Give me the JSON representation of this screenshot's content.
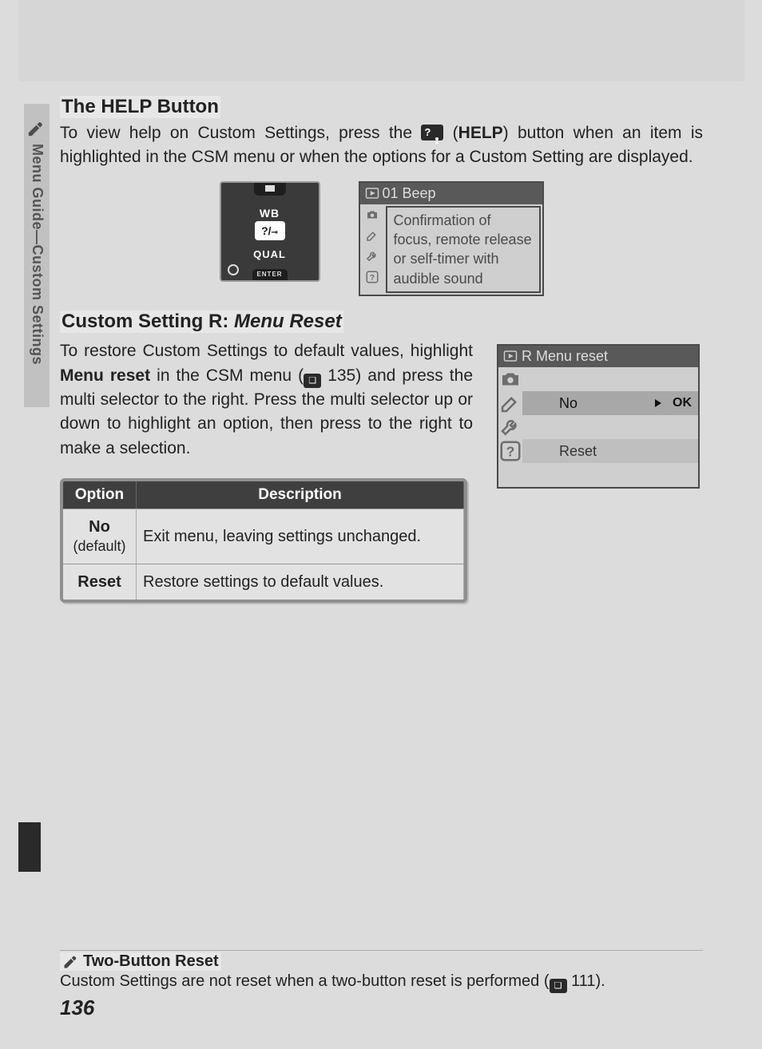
{
  "sidebar": {
    "label": "Menu Guide—Custom Settings"
  },
  "section1": {
    "title": "The HELP Button",
    "para_pre": "To view help on Custom Settings, press the ",
    "help_word": "HELP",
    "para_post": ") button when an item is highlighted in the CSM menu or when the options for a Custom Setting are displayed."
  },
  "camera": {
    "wb": "WB",
    "help": "?/",
    "qual": "QUAL",
    "enter": "ENTER"
  },
  "lcd1": {
    "title": "01 Beep",
    "body": "Confirmation of focus, remote release or self-timer with audible sound"
  },
  "section2": {
    "title_pre": "Custom Setting R: ",
    "title_em": "Menu Reset",
    "para_a": "To restore Custom Settings to default values, highlight ",
    "para_bold": "Menu reset",
    "para_b": " in the CSM menu (",
    "para_ref": " 135) and press the multi selector to the right.  Press the multi selector up or down to highlight an option, then press to the right to make a selection."
  },
  "lcd2": {
    "title": "R Menu reset",
    "row_no": "No",
    "row_ok": "OK",
    "row_reset": "Reset"
  },
  "table": {
    "h1": "Option",
    "h2": "Description",
    "rows": [
      {
        "opt_bold": "No",
        "opt_paren": "(default)",
        "desc": "Exit menu, leaving settings unchanged."
      },
      {
        "opt_bold": "Reset",
        "opt_paren": "",
        "desc": "Restore settings to default values."
      }
    ]
  },
  "footer": {
    "title": "Two-Button Reset",
    "body_pre": "Custom Settings are not reset when a two-button reset is performed (",
    "body_ref": " 111)."
  },
  "page_number": "136"
}
